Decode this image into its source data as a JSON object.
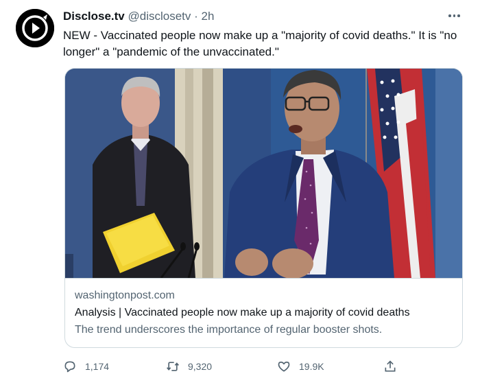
{
  "tweet": {
    "author_name": "Disclose.tv",
    "handle": "@disclosetv",
    "separator": "·",
    "time": "2h",
    "text": "NEW - Vaccinated people now make up a \"majority of covid deaths.\" It is \"no longer\" a \"pandemic of the unvaccinated.\""
  },
  "card": {
    "domain": "washingtonpost.com",
    "headline": "Analysis | Vaccinated people now make up a majority of covid deaths",
    "description": "The trend underscores the importance of regular booster shots."
  },
  "actions": {
    "replies": "1,174",
    "retweets": "9,320",
    "likes": "19.9K"
  },
  "icons": {
    "avatar": "play-logo-icon",
    "more": "more-options-icon",
    "reply": "reply-icon",
    "retweet": "retweet-icon",
    "like": "heart-icon",
    "share": "share-icon"
  },
  "colors": {
    "text": "#0f1419",
    "secondary": "#536471",
    "border": "#cfd9de"
  }
}
